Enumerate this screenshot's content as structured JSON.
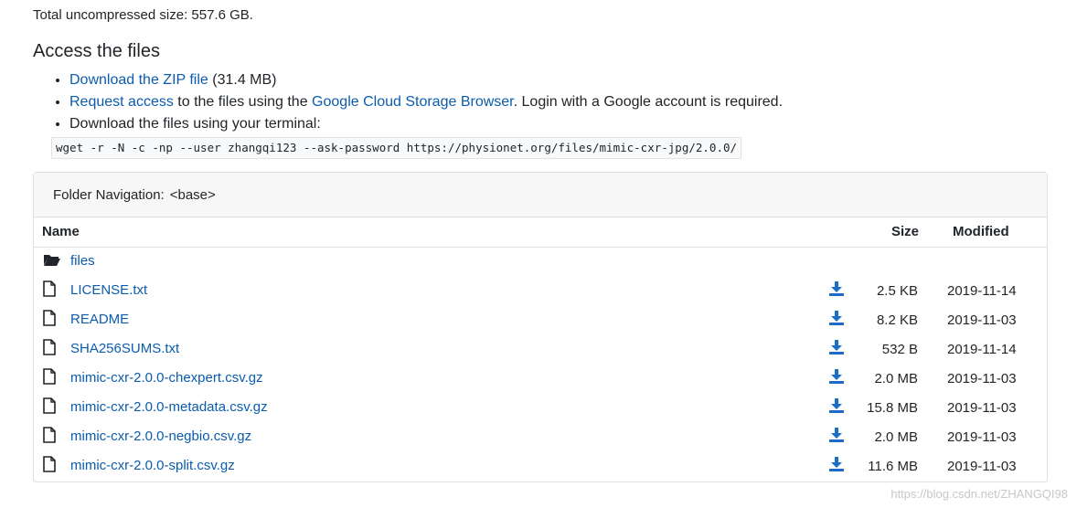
{
  "summary": {
    "uncompressed": "Total uncompressed size: 557.6 GB."
  },
  "access": {
    "title": "Access the files",
    "zip_link": "Download the ZIP file",
    "zip_size": " (31.4 MB)",
    "request_link": "Request access",
    "request_mid": " to the files using the ",
    "gcs_link": "Google Cloud Storage Browser",
    "request_tail": ". Login with a Google account is required.",
    "terminal_text": "Download the files using your terminal:",
    "wget_command": "wget -r -N -c -np --user zhangqi123 --ask-password https://physionet.org/files/mimic-cxr-jpg/2.0.0/"
  },
  "navigation": {
    "label": "Folder Navigation:",
    "path": "<base>"
  },
  "table": {
    "headers": {
      "name": "Name",
      "size": "Size",
      "modified": "Modified"
    },
    "folders": [
      {
        "name": "files",
        "icon": "folder-open-icon"
      }
    ],
    "files": [
      {
        "name": "LICENSE.txt",
        "size": "2.5 KB",
        "modified": "2019-11-14"
      },
      {
        "name": "README",
        "size": "8.2 KB",
        "modified": "2019-11-03"
      },
      {
        "name": "SHA256SUMS.txt",
        "size": "532 B",
        "modified": "2019-11-14"
      },
      {
        "name": "mimic-cxr-2.0.0-chexpert.csv.gz",
        "size": "2.0 MB",
        "modified": "2019-11-03"
      },
      {
        "name": "mimic-cxr-2.0.0-metadata.csv.gz",
        "size": "15.8 MB",
        "modified": "2019-11-03"
      },
      {
        "name": "mimic-cxr-2.0.0-negbio.csv.gz",
        "size": "2.0 MB",
        "modified": "2019-11-03"
      },
      {
        "name": "mimic-cxr-2.0.0-split.csv.gz",
        "size": "11.6 MB",
        "modified": "2019-11-03"
      }
    ]
  },
  "watermark": "https://blog.csdn.net/ZHANGQI98",
  "colors": {
    "link": "#0b5cad",
    "download_icon": "#1a6ec7",
    "header_bg": "#f7f7f7",
    "border": "#dfdfdf"
  }
}
